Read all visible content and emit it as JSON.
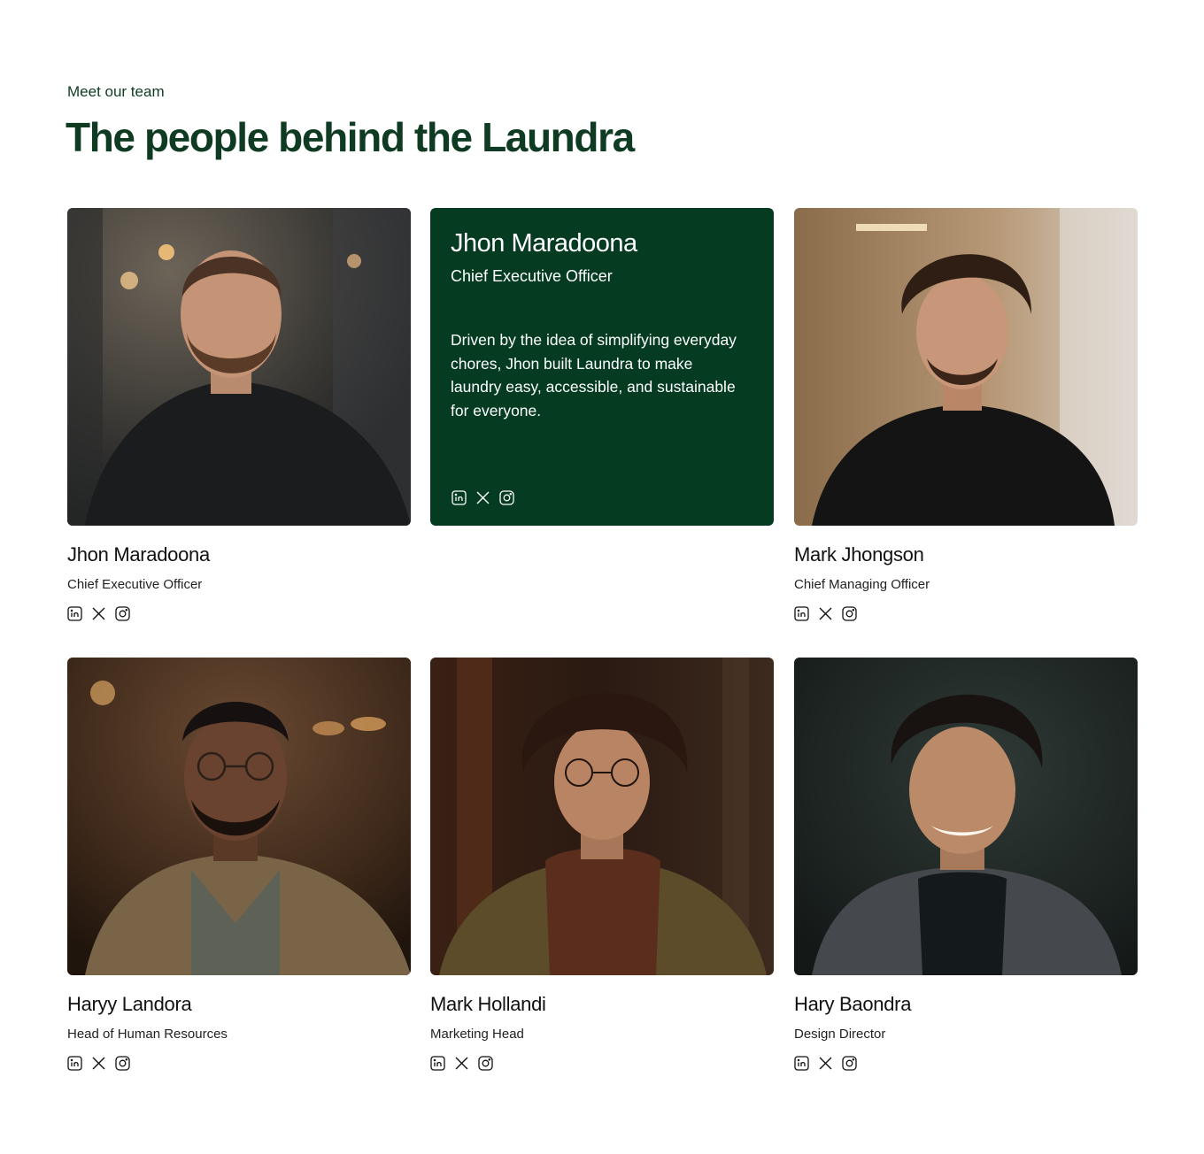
{
  "header": {
    "eyebrow": "Meet our team",
    "title": "The people behind the Laundra"
  },
  "featured": {
    "name": "Jhon Maradoona",
    "role": "Chief Executive Officer",
    "bio": "Driven by the idea of simplifying everyday chores, Jhon built Laundra to make laundry easy, accessible, and sustainable for everyone.",
    "socials": [
      "linkedin-icon",
      "x-icon",
      "instagram-icon"
    ]
  },
  "team": [
    {
      "name": "Jhon Maradoona",
      "role": "Chief Executive Officer"
    },
    {
      "name": "Mark Jhongson",
      "role": "Chief Managing Officer"
    },
    {
      "name": "Haryy Landora",
      "role": "Head of Human Resources"
    },
    {
      "name": "Mark Hollandi",
      "role": "Marketing Head"
    },
    {
      "name": "Hary Baondra",
      "role": "Design Director"
    }
  ],
  "colors": {
    "brand_green": "#043b21",
    "heading_green": "#0e3b22"
  }
}
